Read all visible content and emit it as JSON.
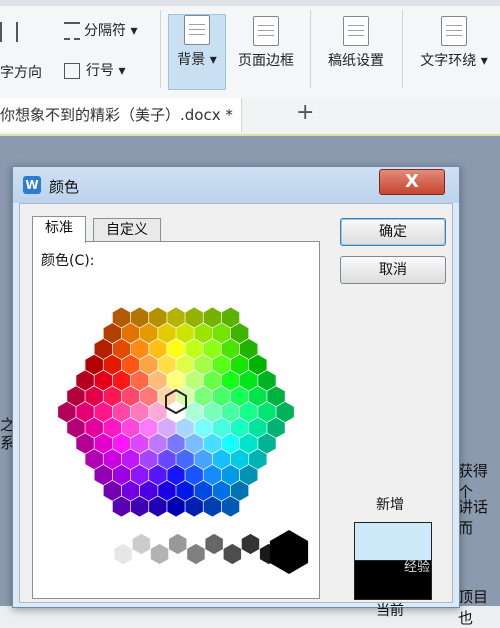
{
  "ribbon": {
    "text_direction": "字方向",
    "separator": "分隔符",
    "line_number": "行号",
    "background": "背景",
    "page_border": "页面边框",
    "manuscript": "稿纸设置",
    "wrap": "文字环绕"
  },
  "doc_tab": {
    "title": "你想象不到的精彩（美子）.docx *",
    "plus": "+"
  },
  "doc_fragments": [
    "之",
    "系",
    "获得个",
    "讲话而",
    "顶目也"
  ],
  "dialog": {
    "title": "颜色",
    "close_label": "X",
    "tabs": [
      {
        "label": "标准"
      },
      {
        "label": "自定义"
      }
    ],
    "color_label": "颜色(C):",
    "ok_label": "确定",
    "cancel_label": "取消",
    "new_label": "新增",
    "current_label": "当前",
    "new_color": "#cce9f9",
    "current_color": "#000000"
  },
  "watermark": "经验"
}
